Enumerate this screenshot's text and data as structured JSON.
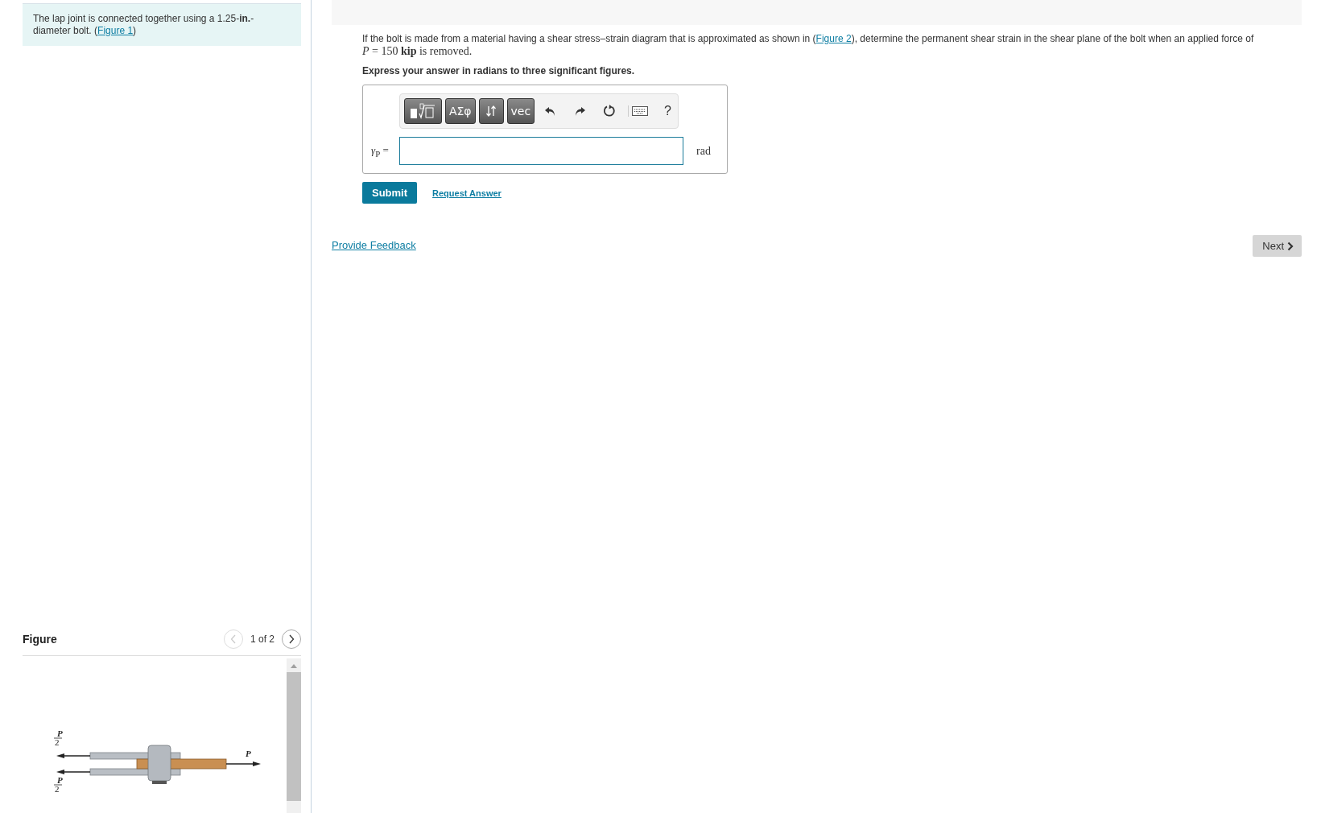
{
  "problem": {
    "text": "The lap joint is connected together using a 1.25-**in.**-diameter bolt. (",
    "link": "Figure 1",
    "after": ")"
  },
  "figure": {
    "title": "Figure",
    "pager": {
      "text": "1 of 2",
      "prev_disabled": true,
      "next_disabled": false
    },
    "labels": {
      "top": {
        "numerator": "P",
        "denominator": "2"
      },
      "bottom": {
        "numerator": "P",
        "denominator": "2"
      },
      "right": "P"
    }
  },
  "part": {
    "question": {
      "before": "If the bolt is made from a material having a shear stress–strain diagram that is approximated as shown in (",
      "link": "Figure 2",
      "after": "), determine the permanent shear strain in the shear plane of the bolt when an applied force of",
      "formula": "*P* = 150 **kip** is removed."
    },
    "instruction": "Express your answer in radians to three significant figures.",
    "toolbar": [
      {
        "kind": "template"
      },
      {
        "kind": "key",
        "label": "ΑΣφ"
      },
      {
        "kind": "arrows"
      },
      {
        "kind": "key",
        "label": "vec"
      },
      {
        "kind": "undo"
      },
      {
        "kind": "redo"
      },
      {
        "kind": "reset"
      },
      {
        "kind": "keyboard"
      },
      {
        "kind": "help",
        "label": "?"
      }
    ],
    "answer": {
      "label": "*γ*$_{P}$ =",
      "unit": "rad"
    },
    "submit": "Submit",
    "request": "Request Answer"
  },
  "feedback": "Provide Feedback",
  "next": "Next"
}
